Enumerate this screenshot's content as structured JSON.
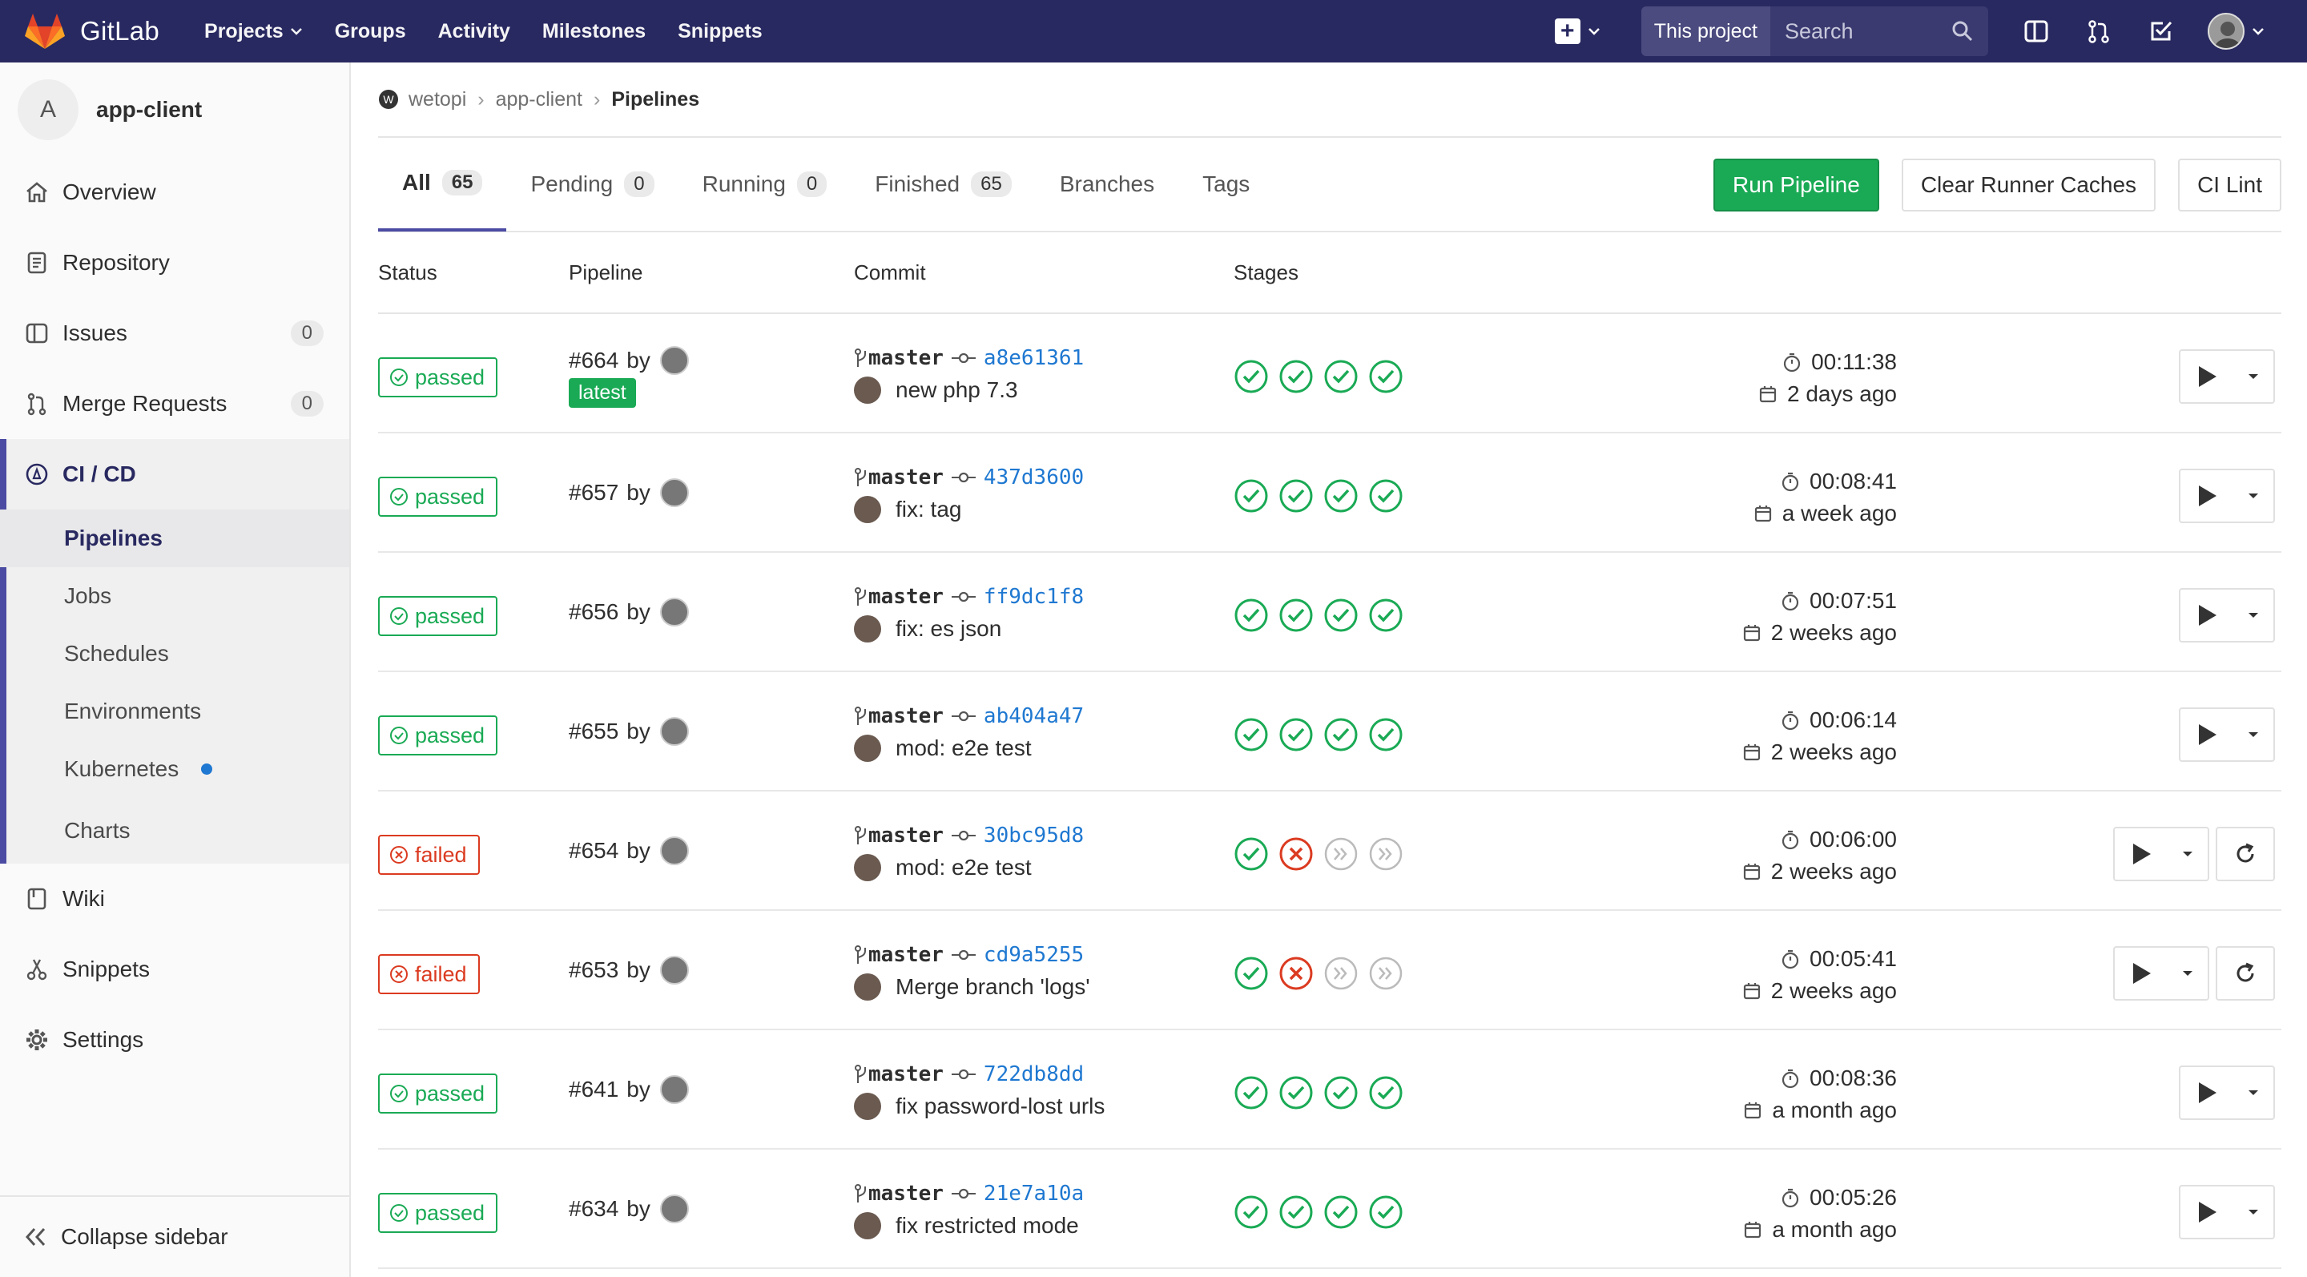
{
  "navbar": {
    "brand": "GitLab",
    "links": [
      "Projects",
      "Groups",
      "Activity",
      "Milestones",
      "Snippets"
    ],
    "search_scope": "This project",
    "search_placeholder": "Search",
    "bg_color": "#292961"
  },
  "sidebar": {
    "project_initial": "A",
    "project_name": "app-client",
    "items": [
      {
        "label": "Overview",
        "icon": "home-icon"
      },
      {
        "label": "Repository",
        "icon": "doc-icon"
      },
      {
        "label": "Issues",
        "icon": "issues-icon",
        "count": "0"
      },
      {
        "label": "Merge Requests",
        "icon": "merge-icon",
        "count": "0"
      }
    ],
    "cicd": {
      "label": "CI / CD",
      "sub": [
        "Pipelines",
        "Jobs",
        "Schedules",
        "Environments",
        "Kubernetes",
        "Charts"
      ]
    },
    "bottom_items": [
      {
        "label": "Wiki",
        "icon": "book-icon"
      },
      {
        "label": "Snippets",
        "icon": "scissors-icon"
      },
      {
        "label": "Settings",
        "icon": "gear-icon"
      }
    ],
    "collapse": "Collapse sidebar"
  },
  "breadcrumb": {
    "group": "wetopi",
    "project": "app-client",
    "current": "Pipelines"
  },
  "tabs": [
    {
      "label": "All",
      "count": "65"
    },
    {
      "label": "Pending",
      "count": "0"
    },
    {
      "label": "Running",
      "count": "0"
    },
    {
      "label": "Finished",
      "count": "65"
    },
    {
      "label": "Branches"
    },
    {
      "label": "Tags"
    }
  ],
  "buttons": {
    "run": "Run Pipeline",
    "clear": "Clear Runner Caches",
    "lint": "CI Lint"
  },
  "table_headers": {
    "status": "Status",
    "pipeline": "Pipeline",
    "commit": "Commit",
    "stages": "Stages"
  },
  "pipelines": [
    {
      "status": "passed",
      "id": "#664",
      "by": "by",
      "latest": "latest",
      "branch": "master",
      "sha": "a8e61361",
      "message": "new php 7.3",
      "stages": [
        "success",
        "success",
        "success",
        "success"
      ],
      "duration": "00:11:38",
      "finished": "2 days ago",
      "retry": false
    },
    {
      "status": "passed",
      "id": "#657",
      "by": "by",
      "branch": "master",
      "sha": "437d3600",
      "message": "fix: tag",
      "stages": [
        "success",
        "success",
        "success",
        "success"
      ],
      "duration": "00:08:41",
      "finished": "a week ago",
      "retry": false
    },
    {
      "status": "passed",
      "id": "#656",
      "by": "by",
      "branch": "master",
      "sha": "ff9dc1f8",
      "message": "fix: es json",
      "stages": [
        "success",
        "success",
        "success",
        "success"
      ],
      "duration": "00:07:51",
      "finished": "2 weeks ago",
      "retry": false
    },
    {
      "status": "passed",
      "id": "#655",
      "by": "by",
      "branch": "master",
      "sha": "ab404a47",
      "message": "mod: e2e test",
      "stages": [
        "success",
        "success",
        "success",
        "success"
      ],
      "duration": "00:06:14",
      "finished": "2 weeks ago",
      "retry": false
    },
    {
      "status": "failed",
      "id": "#654",
      "by": "by",
      "branch": "master",
      "sha": "30bc95d8",
      "message": "mod: e2e test",
      "stages": [
        "success",
        "failed",
        "skipped",
        "skipped"
      ],
      "duration": "00:06:00",
      "finished": "2 weeks ago",
      "retry": true
    },
    {
      "status": "failed",
      "id": "#653",
      "by": "by",
      "branch": "master",
      "sha": "cd9a5255",
      "message": "Merge branch 'logs'",
      "stages": [
        "success",
        "failed",
        "skipped",
        "skipped"
      ],
      "duration": "00:05:41",
      "finished": "2 weeks ago",
      "retry": true
    },
    {
      "status": "passed",
      "id": "#641",
      "by": "by",
      "branch": "master",
      "sha": "722db8dd",
      "message": "fix password-lost urls",
      "stages": [
        "success",
        "success",
        "success",
        "success"
      ],
      "duration": "00:08:36",
      "finished": "a month ago",
      "retry": false
    },
    {
      "status": "passed",
      "id": "#634",
      "by": "by",
      "branch": "master",
      "sha": "21e7a10a",
      "message": "fix restricted mode",
      "stages": [
        "success",
        "success",
        "success",
        "success"
      ],
      "duration": "00:05:26",
      "finished": "a month ago",
      "retry": false
    }
  ],
  "colors": {
    "success": "#1aaa55",
    "failed": "#db3b21",
    "link": "#1f78d1",
    "accent": "#4b4ba3"
  }
}
